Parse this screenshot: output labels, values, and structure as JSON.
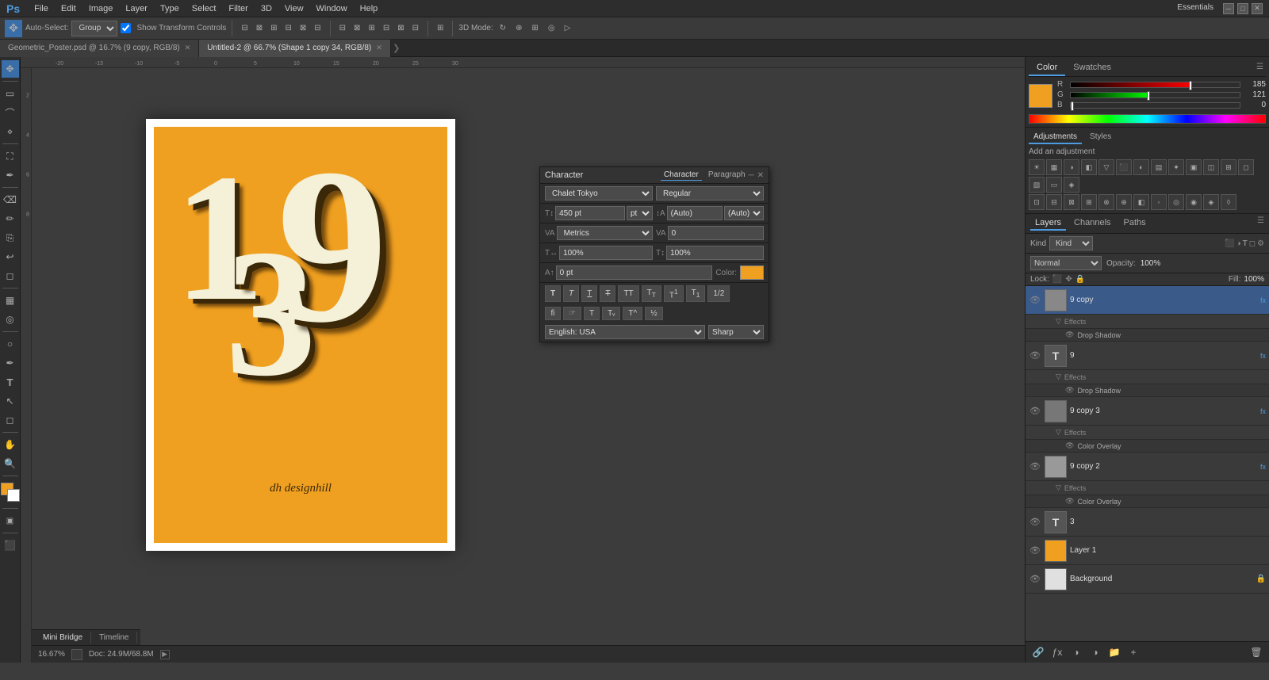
{
  "app": {
    "name": "Ps",
    "title": "Adobe Photoshop"
  },
  "menubar": {
    "items": [
      "File",
      "Edit",
      "Image",
      "Layer",
      "Type",
      "Select",
      "Filter",
      "3D",
      "View",
      "Window",
      "Help"
    ],
    "workspace": "Essentials"
  },
  "optionsbar": {
    "auto_select_label": "Auto-Select:",
    "auto_select_value": "Group",
    "show_transform": "Show Transform Controls",
    "mode_3d": "3D Mode:"
  },
  "tabs": [
    {
      "title": "Geometric_Poster.psd @ 16.7% (9 copy, RGB/8)",
      "active": false
    },
    {
      "title": "Untitled-2 @ 66.7% (Shape 1 copy 34, RGB/8)",
      "active": true
    }
  ],
  "statusbar": {
    "zoom": "16.67%",
    "doc_size": "Doc: 24.9M/68.8M"
  },
  "bottom_tabs": [
    {
      "label": "Mini Bridge",
      "active": true
    },
    {
      "label": "Timeline",
      "active": false
    }
  ],
  "color_panel": {
    "tabs": [
      "Color",
      "Swatches"
    ],
    "active_tab": "Color",
    "swatch_color": "#f0a020",
    "r_value": "185",
    "g_value": "121",
    "b_value": "0",
    "r_percent": 72,
    "g_percent": 47,
    "b_percent": 0
  },
  "adjustments_panel": {
    "tabs": [
      "Adjustments",
      "Styles"
    ],
    "active_tab": "Adjustments",
    "header": "Add an adjustment",
    "icons": [
      "☀",
      "▦",
      "◑",
      "◧",
      "▽",
      "⬛",
      "◐",
      "▤",
      "✦",
      "▣",
      "◫",
      "⊞"
    ]
  },
  "layers_panel": {
    "tabs": [
      "Layers",
      "Channels",
      "Paths"
    ],
    "active_tab": "Layers",
    "filter_kind": "Kind",
    "blend_mode": "Normal",
    "opacity": "100%",
    "lock_label": "Lock:",
    "fill_label": "Fill:",
    "fill_value": "100%",
    "items": [
      {
        "id": "layer-9copy",
        "name": "9 copy",
        "type": "shape",
        "visible": true,
        "selected": true,
        "has_effects": true,
        "effects": [
          "Effects",
          "Drop Shadow"
        ],
        "thumb": "shape"
      },
      {
        "id": "layer-9",
        "name": "9",
        "type": "text",
        "visible": true,
        "selected": false,
        "has_effects": true,
        "effects": [
          "Effects",
          "Drop Shadow"
        ],
        "thumb": "T"
      },
      {
        "id": "layer-9copy3",
        "name": "9 copy 3",
        "type": "shape",
        "visible": true,
        "selected": false,
        "has_effects": true,
        "effects": [
          "Effects",
          "Color Overlay"
        ],
        "thumb": "shape"
      },
      {
        "id": "layer-9copy2",
        "name": "9 copy 2",
        "type": "shape",
        "visible": true,
        "selected": false,
        "has_effects": true,
        "effects": [
          "Effects",
          "Color Overlay"
        ],
        "thumb": "shape"
      },
      {
        "id": "layer-3",
        "name": "3",
        "type": "text",
        "visible": true,
        "selected": false,
        "has_effects": false,
        "thumb": "T"
      },
      {
        "id": "layer-1",
        "name": "Layer 1",
        "type": "normal",
        "visible": true,
        "selected": false,
        "has_effects": false,
        "thumb": "orange"
      },
      {
        "id": "layer-bg",
        "name": "Background",
        "type": "background",
        "visible": true,
        "selected": false,
        "has_effects": false,
        "thumb": "white"
      }
    ]
  },
  "character_panel": {
    "title": "Character",
    "tabs": [
      "Character",
      "Paragraph"
    ],
    "active_tab": "Character",
    "font_name": "Chalet Tokyo",
    "font_style": "Regular",
    "font_size": "450 pt",
    "leading": "(Auto)",
    "tracking_label": "VA",
    "tracking_value": "Metrics",
    "kerning_value": "0",
    "scale_h": "100%",
    "scale_v": "100%",
    "baseline": "0 pt",
    "color_label": "Color:",
    "color_value": "#f0a020",
    "language": "English: USA",
    "aa_method": "Sharp",
    "style_buttons": [
      "T",
      "T",
      "T",
      "T",
      "TT",
      "T₁",
      "T",
      "Tₐ",
      "T₂",
      "f",
      "☞",
      "T",
      "Tᵥ",
      "T^",
      "1/2"
    ]
  },
  "poster": {
    "numbers": "139",
    "brand": "dh designhill",
    "bg_color": "#f0a020"
  }
}
